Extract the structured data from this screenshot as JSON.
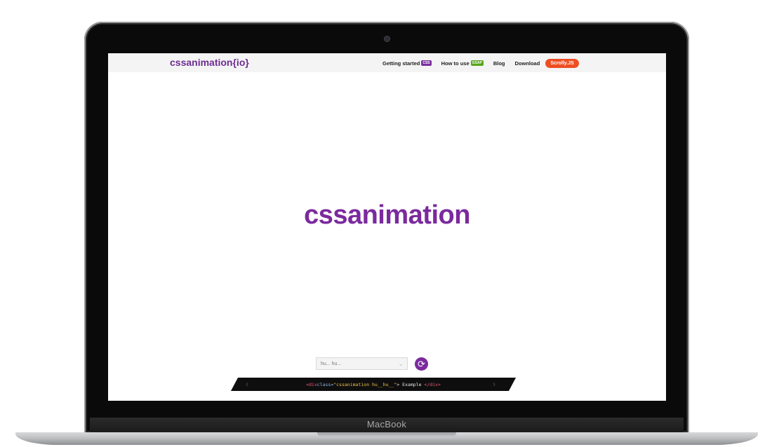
{
  "laptop": {
    "brand": "MacBook"
  },
  "navbar": {
    "logo": "cssanimation{io}",
    "items": [
      {
        "label": "Getting started",
        "tag": "CSS"
      },
      {
        "label": "How to use",
        "tag": "GSAP"
      },
      {
        "label": "Blog"
      },
      {
        "label": "Download"
      }
    ],
    "cta": "Scrolly.JS"
  },
  "hero": {
    "text": "cssanimation"
  },
  "controls": {
    "select_value": "hu... hu...",
    "replay_icon": "refresh-icon"
  },
  "code": {
    "open_tag": "<div",
    "attr": " class=",
    "value": "\"cssanimation hu__hu__\"",
    "close_open": ">",
    "text": " Example ",
    "close_tag": "</div>"
  },
  "colors": {
    "brand_purple": "#7b2a9e",
    "cta_orange": "#ee4e22",
    "gsap_green": "#58a51b"
  }
}
